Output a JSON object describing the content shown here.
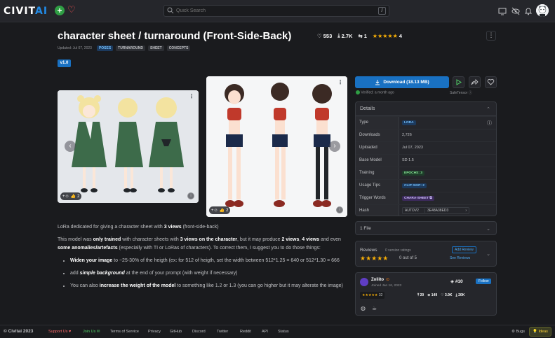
{
  "header": {
    "logo_main": "CIVIT",
    "logo_accent": "AI",
    "search_placeholder": "Quick Search",
    "search_shortcut": "/"
  },
  "model": {
    "title": "character sheet / turnaround (Front-Side-Back)",
    "likes": "553",
    "downloads": "2.7K",
    "comments": "1",
    "rating_count": "4",
    "updated": "Updated: Jul 07, 2023",
    "tags": [
      "POSES",
      "TURNAROUND",
      "SHEET",
      "CONCEPTS"
    ],
    "version": "v1.0"
  },
  "gallery": {
    "image1_reactions": "2",
    "image2_reactions": "2"
  },
  "download": {
    "label": "Download (18.13 MB)",
    "verified": "Verified: a month ago",
    "safetensor": "SafeTensor"
  },
  "details": {
    "heading": "Details",
    "rows": [
      {
        "label": "Type",
        "value": "LORA"
      },
      {
        "label": "Downloads",
        "value": "2,726"
      },
      {
        "label": "Uploaded",
        "value": "Jul 07, 2023"
      },
      {
        "label": "Base Model",
        "value": "SD 1.5"
      },
      {
        "label": "Training",
        "value": "EPOCHS: 3"
      },
      {
        "label": "Usage Tips",
        "value": "CLIP SKIP: 2"
      },
      {
        "label": "Trigger Words",
        "value": "CHARA-SHEET"
      },
      {
        "label": "Hash",
        "value": "3E48A38ED3",
        "hash_type": "AUTOV2"
      }
    ]
  },
  "files": {
    "label": "1 File"
  },
  "reviews": {
    "heading": "Reviews",
    "version_ratings": "0 version ratings",
    "score": "0 out of 5",
    "add_review": "Add Review",
    "see_reviews": "See Reviews"
  },
  "creator": {
    "name": "Zoliito",
    "joined": "Joined Jan 16, 2023",
    "rank": "#10",
    "follow": "Follow",
    "rating_count": "32",
    "stat1": "20",
    "stat2": "149",
    "stat3": "3.9K",
    "stat4": "20K"
  },
  "description": {
    "p1_a": "LoRa dedicated for giving a character sheet with ",
    "p1_b": "3 views",
    "p1_c": " (front-side-back)",
    "p2_a": "This model was ",
    "p2_b": "only trained",
    "p2_c": " with character sheets with ",
    "p2_d": "3 views on the character",
    "p2_e": ", but it may produce ",
    "p2_f": "2 views",
    "p2_g": ", ",
    "p2_h": "4 views",
    "p2_i": " and even ",
    "p2_j": "some anomalies/artefacts",
    "p2_k": " (especially with TI or LoRas of characters). To correct them, I suggest you to do those things:",
    "li1_a": "Widen your image",
    "li1_b": " to ~25-30% of the heigth (ex: for 512 of heigth, set the width between 512*1.25 = 640 or 512*1.30 = 666",
    "li2_a": "add ",
    "li2_b": "simple background",
    "li2_c": " at the end of your prompt (with weight if necessary)",
    "li3_a": "You can also ",
    "li3_b": "increase the weight of the model",
    "li3_c": " to something like 1.2 or 1.3 (you can go higher but it may alterate the image)"
  },
  "footer": {
    "copyright": "© Civitai 2023",
    "support": "Support Us ♥",
    "join": "Join Us ✉",
    "links": [
      "Terms of Service",
      "Privacy",
      "GitHub",
      "Discord",
      "Twitter",
      "Reddit",
      "API",
      "Status"
    ],
    "bugs": "Bugs",
    "ideas": "Ideas"
  },
  "colors": {
    "accent": "#1971c2",
    "background": "#1a1b1e",
    "panel": "#25262b",
    "star": "#fab005"
  }
}
